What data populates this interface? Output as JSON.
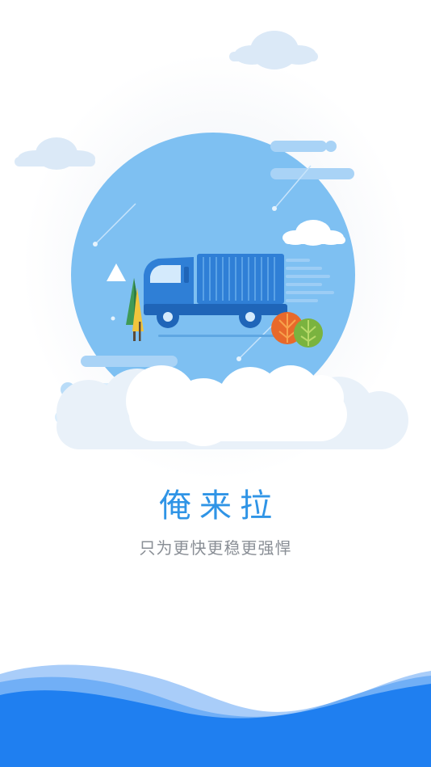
{
  "app": {
    "name": "俺来拉",
    "slogan": "只为更快更稳更强悍"
  },
  "colors": {
    "brand_blue": "#2f94e6",
    "slogan_gray": "#8a8f96",
    "wave_dark": "#1f7ff0",
    "wave_light": "#a9cdf9",
    "circle_bg": "#7ec0f2",
    "truck_blue": "#2f7fd6"
  },
  "icons": [
    "truck-icon",
    "cloud-icon",
    "tree-icon",
    "mountain-icon",
    "bush-icon",
    "shooting-star-icon"
  ]
}
